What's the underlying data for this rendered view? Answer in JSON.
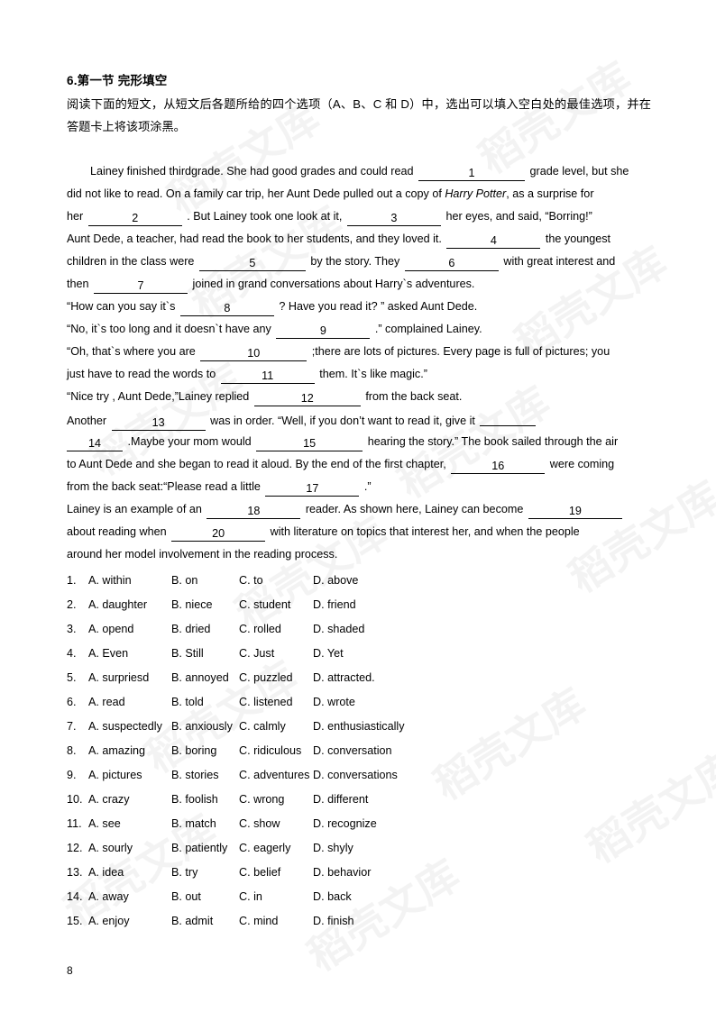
{
  "document": {
    "title": "6.第一节 完形填空",
    "instructions": "阅读下面的短文，从短文后各题所给的四个选项（A、B、C 和 D）中，选出可以填入空白处的最佳选项，并在答题卡上将该项涂黑。",
    "page_number": "8",
    "watermark_text": "稻壳文库"
  },
  "passage": {
    "lines": [
      {
        "indent": true,
        "parts": [
          {
            "t": "text",
            "v": "Lainey finished thirdgrade. She had good grades and could read"
          },
          {
            "t": "blank",
            "v": "1",
            "w": "b-xl"
          },
          {
            "t": "text",
            "v": "grade level, but she"
          }
        ]
      },
      {
        "indent": false,
        "parts": [
          {
            "t": "text",
            "v": "did not like to read. On a family car trip, her Aunt Dede pulled out a copy of "
          },
          {
            "t": "italic",
            "v": "Harry Potter"
          },
          {
            "t": "text",
            "v": ", as a surprise for"
          }
        ]
      },
      {
        "indent": false,
        "parts": [
          {
            "t": "text",
            "v": "her"
          },
          {
            "t": "blank",
            "v": "2",
            "w": "b-lg"
          },
          {
            "t": "text",
            "v": ". But Lainey took one look at it,"
          },
          {
            "t": "blank",
            "v": "3",
            "w": "b-lg"
          },
          {
            "t": "text",
            "v": "her eyes, and said, “Borring!”"
          }
        ]
      },
      {
        "indent": false,
        "parts": [
          {
            "t": "text",
            "v": "Aunt Dede, a teacher, had read the book to her students, and they loved it."
          },
          {
            "t": "blank",
            "v": "4",
            "w": "b-lg"
          },
          {
            "t": "text",
            "v": "the youngest"
          }
        ]
      },
      {
        "indent": false,
        "parts": [
          {
            "t": "text",
            "v": "children in the class were"
          },
          {
            "t": "blank",
            "v": "5",
            "w": "b-xl"
          },
          {
            "t": "text",
            "v": "by the story. They"
          },
          {
            "t": "blank",
            "v": "6",
            "w": "b-lg"
          },
          {
            "t": "text",
            "v": "with great interest and"
          }
        ]
      },
      {
        "indent": false,
        "parts": [
          {
            "t": "text",
            "v": "then"
          },
          {
            "t": "blank",
            "v": "7",
            "w": "b-lg"
          },
          {
            "t": "text",
            "v": "joined in grand conversations about Harry`s adventures."
          }
        ]
      },
      {
        "indent": false,
        "parts": [
          {
            "t": "text",
            "v": "“How can you say it`s"
          },
          {
            "t": "blank",
            "v": "8",
            "w": "b-lg"
          },
          {
            "t": "text",
            "v": "? Have you read it? ” asked Aunt Dede."
          }
        ]
      },
      {
        "indent": false,
        "parts": [
          {
            "t": "text",
            "v": "“No, it`s too long and it doesn`t have any"
          },
          {
            "t": "blank",
            "v": "9",
            "w": "b-lg"
          },
          {
            "t": "text",
            "v": ".” complained Lainey."
          }
        ]
      },
      {
        "indent": false,
        "parts": [
          {
            "t": "text",
            "v": "“Oh, that`s where you are"
          },
          {
            "t": "blank",
            "v": "10",
            "w": "b-xl"
          },
          {
            "t": "text",
            "v": ";there are lots of pictures. Every page is full of pictures; you"
          }
        ]
      },
      {
        "indent": false,
        "parts": [
          {
            "t": "text",
            "v": "just have to read the words to"
          },
          {
            "t": "blank",
            "v": "11",
            "w": "b-lg"
          },
          {
            "t": "text",
            "v": "them. It`s like magic.”"
          }
        ]
      },
      {
        "indent": false,
        "parts": [
          {
            "t": "text",
            "v": "“Nice try , Aunt Dede,”Lainey replied"
          },
          {
            "t": "blank",
            "v": "12",
            "w": "b-xl"
          },
          {
            "t": "text",
            "v": "from the back seat."
          }
        ]
      },
      {
        "indent": false,
        "parts": [
          {
            "t": "text",
            "v": "Another"
          },
          {
            "t": "blank",
            "v": "13",
            "w": "b-lg"
          },
          {
            "t": "text",
            "v": "was in order. “Well, if you don’t want to read it, give it"
          },
          {
            "t": "blank",
            "v": "",
            "w": "b-sm"
          }
        ]
      },
      {
        "indent": false,
        "parts": [
          {
            "t": "blank-left",
            "v": "14",
            "w": "b-sm"
          },
          {
            "t": "text",
            "v": ".Maybe your mom would"
          },
          {
            "t": "blank",
            "v": "15",
            "w": "b-xl"
          },
          {
            "t": "text",
            "v": "hearing the story.” The book sailed through the air"
          }
        ]
      },
      {
        "indent": false,
        "parts": [
          {
            "t": "text",
            "v": "to Aunt Dede and she began to read it aloud. By the end of the first chapter,"
          },
          {
            "t": "blank",
            "v": "16",
            "w": "b-lg"
          },
          {
            "t": "text",
            "v": "were coming"
          }
        ]
      },
      {
        "indent": false,
        "parts": [
          {
            "t": "text",
            "v": "from the back seat:“Please read a little"
          },
          {
            "t": "blank",
            "v": "17",
            "w": "b-lg"
          },
          {
            "t": "text",
            "v": ".”"
          }
        ]
      },
      {
        "indent": false,
        "parts": [
          {
            "t": "text",
            "v": "Lainey is an example of an"
          },
          {
            "t": "blank",
            "v": "18",
            "w": "b-lg"
          },
          {
            "t": "text",
            "v": "reader. As shown here, Lainey can become"
          },
          {
            "t": "blank",
            "v": "19",
            "w": "b-lg"
          }
        ]
      },
      {
        "indent": false,
        "parts": [
          {
            "t": "text",
            "v": "about reading when"
          },
          {
            "t": "blank",
            "v": "20",
            "w": "b-lg"
          },
          {
            "t": "text",
            "v": "with literature on topics that interest her, and when the people"
          }
        ]
      },
      {
        "indent": false,
        "parts": [
          {
            "t": "text",
            "v": "around her model involvement in the reading process."
          }
        ]
      }
    ]
  },
  "options": [
    {
      "num": "1.",
      "a": "A. within",
      "b": "B. on",
      "c": "C. to",
      "d": "D. above"
    },
    {
      "num": "2.",
      "a": "A. daughter",
      "b": "B. niece",
      "c": "C. student",
      "d": "D. friend"
    },
    {
      "num": "3.",
      "a": "A. opend",
      "b": "B. dried",
      "c": "C. rolled",
      "d": "D. shaded"
    },
    {
      "num": "4.",
      "a": "A. Even",
      "b": "B. Still",
      "c": "C. Just",
      "d": "D. Yet"
    },
    {
      "num": "5.",
      "a": "A. surpriesd",
      "b": "B. annoyed",
      "c": "C. puzzled",
      "d": "D. attracted."
    },
    {
      "num": "6.",
      "a": "A. read",
      "b": "B. told",
      "c": "C. listened",
      "d": "D. wrote"
    },
    {
      "num": "7.",
      "a": "A. suspectedly",
      "b": "B. anxiously",
      "c": "C. calmly",
      "d": "D. enthusiastically"
    },
    {
      "num": "8.",
      "a": "A. amazing",
      "b": "B. boring",
      "c": "C. ridiculous",
      "d": "D. conversation"
    },
    {
      "num": "9.",
      "a": "A. pictures",
      "b": "B. stories",
      "c": "C. adventures",
      "d": "D. conversations"
    },
    {
      "num": "10.",
      "a": "A. crazy",
      "b": "B. foolish",
      "c": "C. wrong",
      "d": "D. different"
    },
    {
      "num": "11.",
      "a": "A. see",
      "b": "B. match",
      "c": "C. show",
      "d": "D. recognize"
    },
    {
      "num": "12.",
      "a": "A. sourly",
      "b": "B. patiently",
      "c": "C. eagerly",
      "d": "D. shyly"
    },
    {
      "num": "13.",
      "a": "A. idea",
      "b": "B. try",
      "c": "C. belief",
      "d": "D. behavior"
    },
    {
      "num": "14.",
      "a": "A. away",
      "b": "B. out",
      "c": "C. in",
      "d": "D. back"
    },
    {
      "num": "15.",
      "a": "A. enjoy",
      "b": "B. admit",
      "c": "C. mind",
      "d": "D. finish"
    }
  ]
}
